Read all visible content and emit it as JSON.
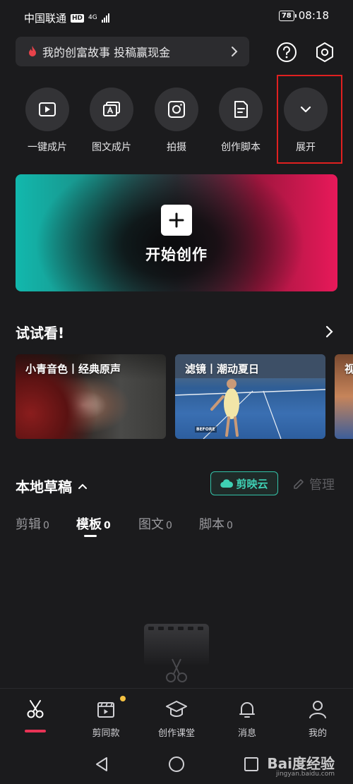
{
  "status_bar": {
    "carrier": "中国联通",
    "hd": "HD",
    "network": "4G",
    "battery": "78",
    "time": "08:18"
  },
  "banner": {
    "text": "我的创富故事 投稿赢现金"
  },
  "tools": [
    {
      "label": "一键成片",
      "icon": "play-square-icon"
    },
    {
      "label": "图文成片",
      "icon": "text-to-video-icon"
    },
    {
      "label": "拍摄",
      "icon": "camera-icon"
    },
    {
      "label": "创作脚本",
      "icon": "script-document-icon"
    },
    {
      "label": "展开",
      "icon": "chevron-down-icon"
    }
  ],
  "start_card": {
    "label": "开始创作"
  },
  "try_section": {
    "title": "试试看!",
    "cards": [
      {
        "caption": "小青音色丨经典原声"
      },
      {
        "caption": "滤镜丨潮动夏日",
        "tag": "BEFORE"
      },
      {
        "caption": "视"
      }
    ]
  },
  "drafts": {
    "title": "本地草稿",
    "cloud_label": "剪映云",
    "manage_label": "管理",
    "tabs": [
      {
        "name": "剪辑",
        "count": "0"
      },
      {
        "name": "模板",
        "count": "0"
      },
      {
        "name": "图文",
        "count": "0"
      },
      {
        "name": "脚本",
        "count": "0"
      }
    ],
    "active_tab": "模板"
  },
  "bottom_nav": {
    "items": [
      {
        "label": ""
      },
      {
        "label": "剪同款"
      },
      {
        "label": "创作课堂"
      },
      {
        "label": "消息"
      },
      {
        "label": "我的"
      }
    ]
  },
  "watermark": {
    "main": "Bai度经验",
    "sub": "jingyan.baidu.com"
  },
  "colors": {
    "background": "#1b1b1d",
    "accent_red": "#e83355",
    "cloud_teal": "#34c3a8",
    "highlight_box": "#e02020"
  }
}
